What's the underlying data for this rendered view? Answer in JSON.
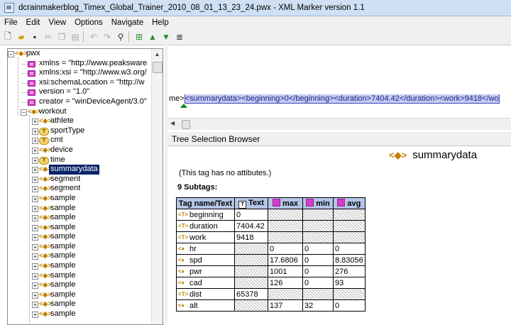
{
  "window": {
    "title": "dcrainmakerblog_Timex_Global_Trainer_2010_08_01_13_23_24.pwx  -  XML Marker version 1.1"
  },
  "menu": [
    "File",
    "Edit",
    "View",
    "Options",
    "Navigate",
    "Help"
  ],
  "toolbar_icons": [
    "new-icon",
    "open-icon",
    "save-icon",
    "cut-icon",
    "copy-icon",
    "paste-icon",
    "undo-icon",
    "redo-icon",
    "find-icon",
    "tree-icon",
    "up-icon",
    "down-icon",
    "list-icon"
  ],
  "tree": {
    "root": "pwx",
    "attributes": [
      "xmlns = \"http://www.peaksware",
      "xmlns:xsi = \"http://www.w3.org/",
      "xsi:schemaLocation = \"http://w",
      "version = \"1.0\"",
      "creator = \"winDeviceAgent/3.0\""
    ],
    "workout": "workout",
    "children": [
      {
        "label": "athlete",
        "kind": "element"
      },
      {
        "label": "sportType",
        "kind": "text"
      },
      {
        "label": "cmt",
        "kind": "text"
      },
      {
        "label": "device",
        "kind": "element"
      },
      {
        "label": "time",
        "kind": "text"
      },
      {
        "label": "summarydata",
        "kind": "element",
        "selected": true
      },
      {
        "label": "segment",
        "kind": "element"
      },
      {
        "label": "segment",
        "kind": "element"
      },
      {
        "label": "sample",
        "kind": "element"
      },
      {
        "label": "sample",
        "kind": "element"
      },
      {
        "label": "sample",
        "kind": "element"
      },
      {
        "label": "sample",
        "kind": "element"
      },
      {
        "label": "sample",
        "kind": "element"
      },
      {
        "label": "sample",
        "kind": "element"
      },
      {
        "label": "sample",
        "kind": "element"
      },
      {
        "label": "sample",
        "kind": "element"
      },
      {
        "label": "sample",
        "kind": "element"
      },
      {
        "label": "sample",
        "kind": "element"
      },
      {
        "label": "sample",
        "kind": "element"
      },
      {
        "label": "sample",
        "kind": "element"
      },
      {
        "label": "sample",
        "kind": "element"
      }
    ]
  },
  "xml_view": {
    "prefix": "me>",
    "highlight": "<summarydata><beginning>0</beginning><duration>7404.42</duration><work>9418</wo"
  },
  "browser": {
    "header": "Tree Selection Browser",
    "element": "summarydata",
    "no_attributes": "(This tag has no attibutes.)",
    "subtags_label": "9 Subtags:",
    "columns": [
      "Tag name/Text",
      "Text",
      "max",
      "min",
      "avg"
    ],
    "rows": [
      {
        "kind": "text",
        "name": "beginning",
        "text": "0",
        "max": null,
        "min": null,
        "avg": null
      },
      {
        "kind": "text",
        "name": "duration",
        "text": "7404.42",
        "max": null,
        "min": null,
        "avg": null
      },
      {
        "kind": "text",
        "name": "work",
        "text": "9418",
        "max": null,
        "min": null,
        "avg": null
      },
      {
        "kind": "attr",
        "name": "hr",
        "text": null,
        "max": "0",
        "min": "0",
        "avg": "0"
      },
      {
        "kind": "attr",
        "name": "spd",
        "text": null,
        "max": "17.6806",
        "min": "0",
        "avg": "8.83056"
      },
      {
        "kind": "attr",
        "name": "pwr",
        "text": null,
        "max": "1001",
        "min": "0",
        "avg": "276"
      },
      {
        "kind": "attr",
        "name": "cad",
        "text": null,
        "max": "126",
        "min": "0",
        "avg": "93"
      },
      {
        "kind": "text",
        "name": "dist",
        "text": "65378",
        "max": null,
        "min": null,
        "avg": null
      },
      {
        "kind": "attr",
        "name": "alt",
        "text": null,
        "max": "137",
        "min": "32",
        "avg": "0"
      }
    ]
  }
}
